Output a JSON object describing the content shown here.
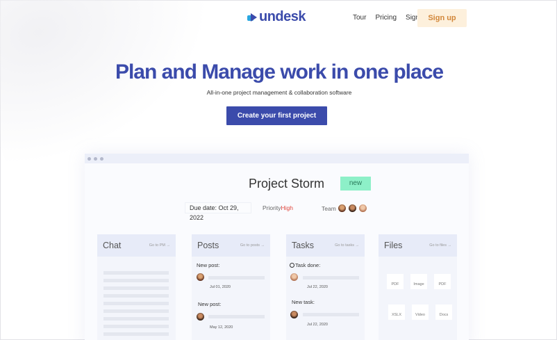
{
  "header": {
    "logo_text": "undesk",
    "nav": [
      "Tour",
      "Pricing",
      "Sign in"
    ],
    "signup_label": "Sign up"
  },
  "hero": {
    "title": "Plan and Manage work in one place",
    "subtitle": "All-in-one project management & collaboration software",
    "cta_label": "Create your first project"
  },
  "project": {
    "title": "Project Storm",
    "badge": "new",
    "due": "Due date: Oct 29, 2022",
    "priority_label": "Priority",
    "priority_value": "High",
    "team_label": "Team"
  },
  "cards": {
    "chat": {
      "title": "Chat",
      "link": "Go to PM →"
    },
    "posts": {
      "title": "Posts",
      "link": "Go to posts →",
      "items": [
        {
          "label": "New post:",
          "date": "Jul 01, 2020"
        },
        {
          "label": "New post:",
          "date": "May 12, 2020"
        }
      ]
    },
    "tasks": {
      "title": "Tasks",
      "link": "Go to tasks →",
      "items": [
        {
          "label": "Task done:",
          "date": "Jul 22, 2020"
        },
        {
          "label": "New task:",
          "date": "Jul 22, 2020"
        }
      ]
    },
    "files": {
      "title": "Files",
      "link": "Go to files →",
      "items": [
        "PDF",
        "Image",
        "PDF",
        "XSLX",
        "Video",
        "Docs"
      ]
    }
  },
  "colors": {
    "brand": "#3b4bab",
    "accent": "#2aa7e0",
    "signup_bg": "#fdf0dc",
    "new_badge": "#8df0c8",
    "priority_high": "#e0463c"
  }
}
